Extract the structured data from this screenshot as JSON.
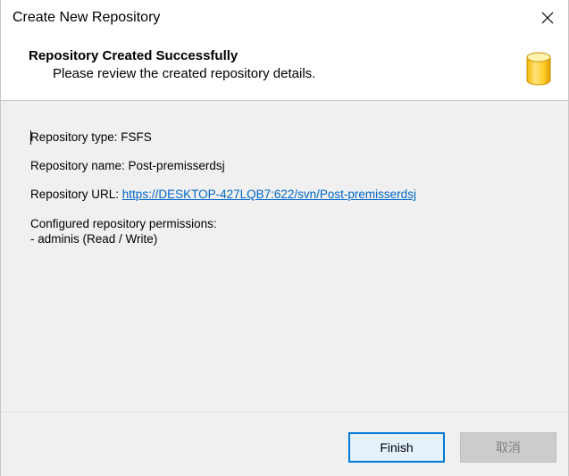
{
  "window": {
    "title": "Create New Repository",
    "close_icon": "close-icon"
  },
  "header": {
    "title": "Repository Created Successfully",
    "subtitle": "Please review the created repository details.",
    "icon": "database-icon"
  },
  "details": {
    "type_line": "Repository type: FSFS",
    "name_line": "Repository name: Post-premisserdsj",
    "url_label": "Repository URL: ",
    "url": "https://DESKTOP-427LQB7:622/svn/Post-premisserdsj",
    "permissions_heading": "Configured repository permissions:",
    "permissions_items": [
      "- adminis (Read / Write)"
    ]
  },
  "footer": {
    "finish_label": "Finish",
    "cancel_label": "取消"
  },
  "colors": {
    "link": "#0066cc",
    "focus_border": "#0078d7",
    "icon_fill": "#ffd13a"
  }
}
